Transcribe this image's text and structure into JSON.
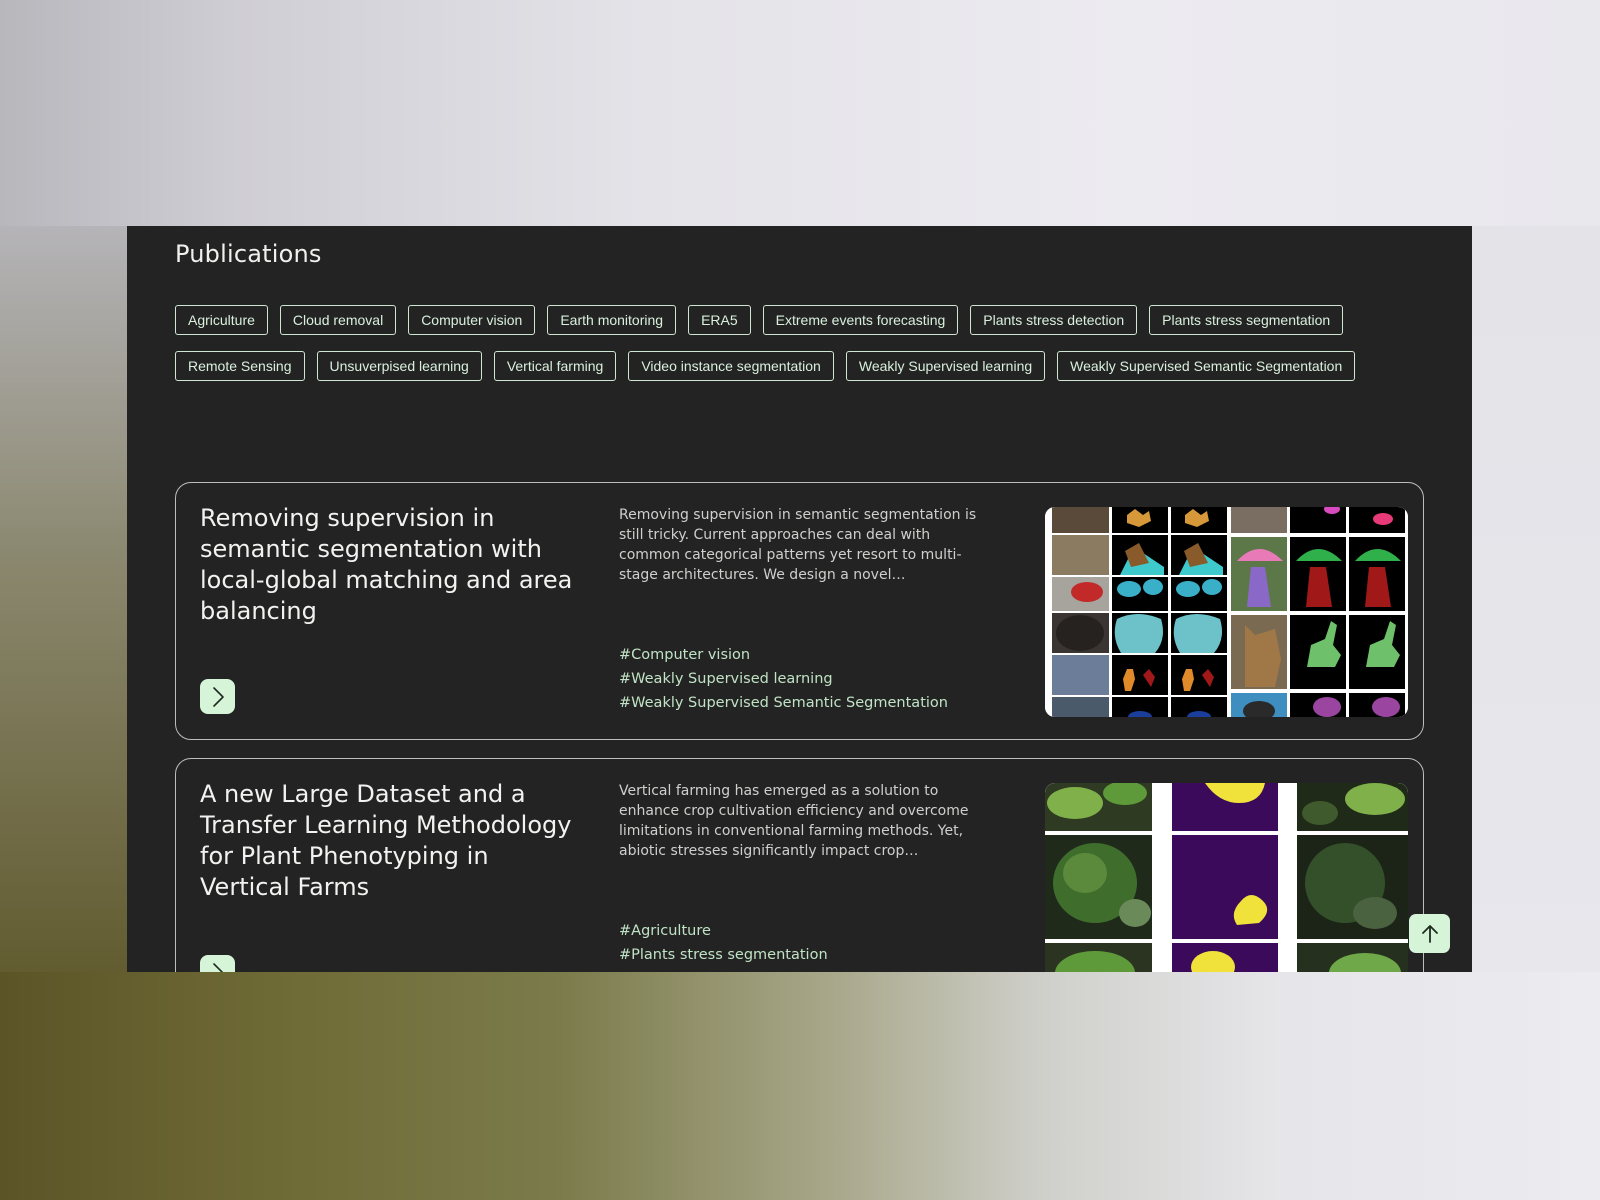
{
  "section": {
    "title": "Publications"
  },
  "filter_tags": [
    "Agriculture",
    "Cloud removal",
    "Computer vision",
    "Earth monitoring",
    "ERA5",
    "Extreme events forecasting",
    "Plants stress detection",
    "Plants stress segmentation",
    "Remote Sensing",
    "Unsuverpised learning",
    "Vertical farming",
    "Video instance segmentation",
    "Weakly Supervised learning",
    "Weakly Supervised Semantic Segmentation"
  ],
  "publications": [
    {
      "title": "Removing supervision in semantic segmentation with local-global matching and area balancing",
      "abstract": "Removing supervision in semantic segmentation is still tricky. Current approaches can deal with common categorical patterns yet resort to multi-stage architectures. We design a novel…",
      "tags": [
        "#Computer vision",
        "#Weakly Supervised learning",
        "#Weakly Supervised Semantic Segmentation"
      ],
      "open_icon": "chevron-right-icon",
      "image": "segmentation-examples-grid"
    },
    {
      "title": "A new Large Dataset and a Transfer Learning Methodology for Plant Phenotyping in Vertical Farms",
      "abstract": "Vertical farming has emerged as a solution to enhance crop cultivation efficiency and overcome limitations in conventional farming methods. Yet, abiotic stresses significantly impact crop…",
      "tags": [
        "#Agriculture",
        "#Plants stress segmentation"
      ],
      "open_icon": "chevron-right-icon",
      "image": "plant-leaves-segmentation-grid"
    }
  ],
  "scroll_top_icon": "arrow-up-icon",
  "colors": {
    "panel_bg": "#242324",
    "accent": "#d6f5d8",
    "tag_text": "#d8f0dc",
    "hashtag_text": "#bfe3c4"
  }
}
